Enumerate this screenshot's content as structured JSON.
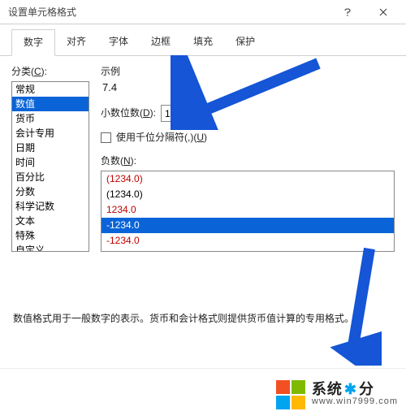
{
  "window": {
    "title": "设置单元格格式"
  },
  "tabs": [
    {
      "label": "数字",
      "active": true
    },
    {
      "label": "对齐"
    },
    {
      "label": "字体"
    },
    {
      "label": "边框"
    },
    {
      "label": "填充"
    },
    {
      "label": "保护"
    }
  ],
  "left": {
    "label_pre": "分类(",
    "label_u": "C",
    "label_post": "):",
    "items": [
      "常规",
      "数值",
      "货币",
      "会计专用",
      "日期",
      "时间",
      "百分比",
      "分数",
      "科学记数",
      "文本",
      "特殊",
      "自定义"
    ],
    "selected_index": 1
  },
  "right": {
    "example_label": "示例",
    "example_value": "7.4",
    "decimal_pre": "小数位数(",
    "decimal_u": "D",
    "decimal_post": "):",
    "decimal_value": "1",
    "sep_pre": "使用千位分隔符(,)(",
    "sep_u": "U",
    "sep_post": ")",
    "neg_pre": "负数(",
    "neg_u": "N",
    "neg_post": "):",
    "neg_items": [
      {
        "text": "(1234.0)",
        "cls": "red"
      },
      {
        "text": "(1234.0)",
        "cls": "blk"
      },
      {
        "text": "1234.0",
        "cls": "red"
      },
      {
        "text": "-1234.0",
        "cls": "sel"
      },
      {
        "text": "-1234.0",
        "cls": "red"
      }
    ]
  },
  "hint": "数值格式用于一般数字的表示。货币和会计格式则提供货币值计算的专用格式。",
  "watermark": {
    "top_a": "系统",
    "top_star": "✱",
    "top_b": "分",
    "bottom": "www.win7999.com"
  }
}
